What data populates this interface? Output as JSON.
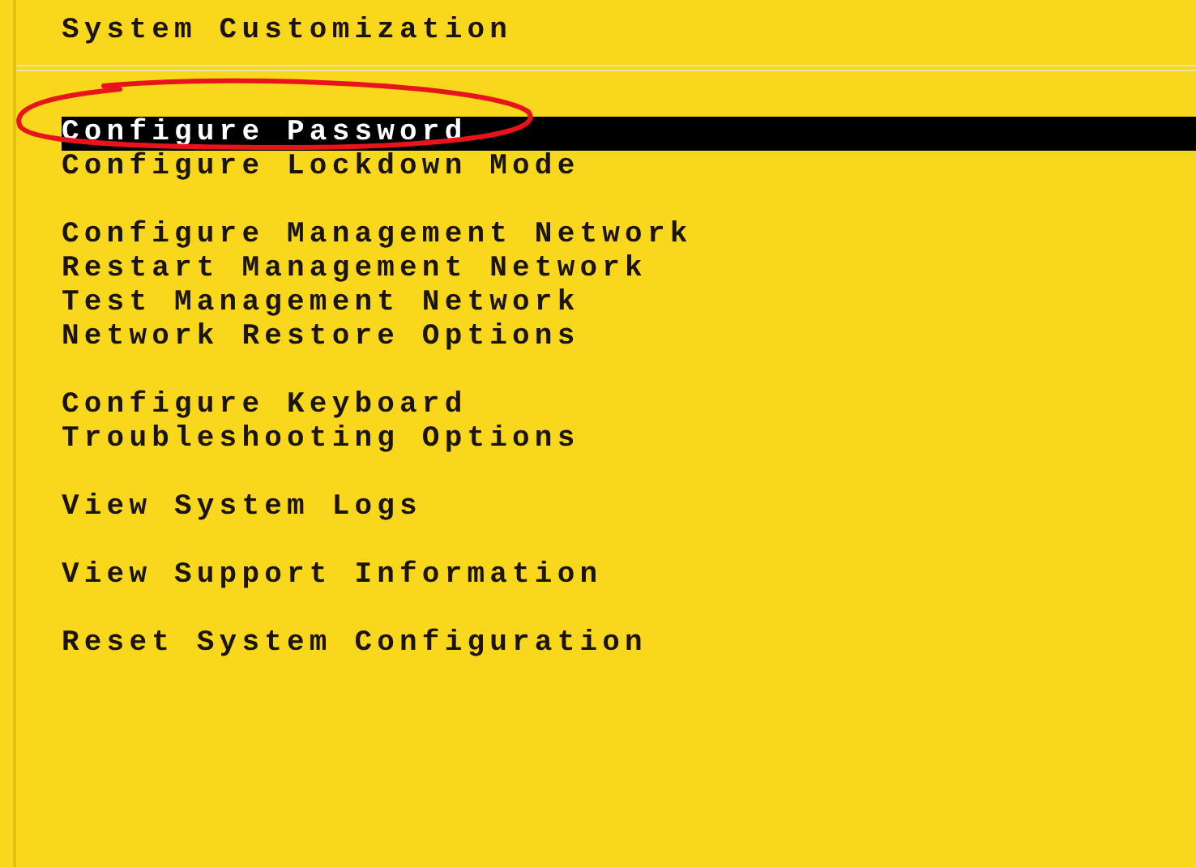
{
  "title": "System Customization",
  "menu_groups": [
    {
      "items": [
        {
          "label": "Configure Password",
          "selected": true
        },
        {
          "label": "Configure Lockdown Mode",
          "selected": false
        }
      ]
    },
    {
      "items": [
        {
          "label": "Configure Management Network",
          "selected": false
        },
        {
          "label": "Restart Management Network",
          "selected": false
        },
        {
          "label": "Test Management Network",
          "selected": false
        },
        {
          "label": "Network Restore Options",
          "selected": false
        }
      ]
    },
    {
      "items": [
        {
          "label": "Configure Keyboard",
          "selected": false
        },
        {
          "label": "Troubleshooting Options",
          "selected": false
        }
      ]
    },
    {
      "items": [
        {
          "label": "View System Logs",
          "selected": false
        }
      ]
    },
    {
      "items": [
        {
          "label": "View Support Information",
          "selected": false
        }
      ]
    },
    {
      "items": [
        {
          "label": "Reset System Configuration",
          "selected": false
        }
      ]
    }
  ]
}
